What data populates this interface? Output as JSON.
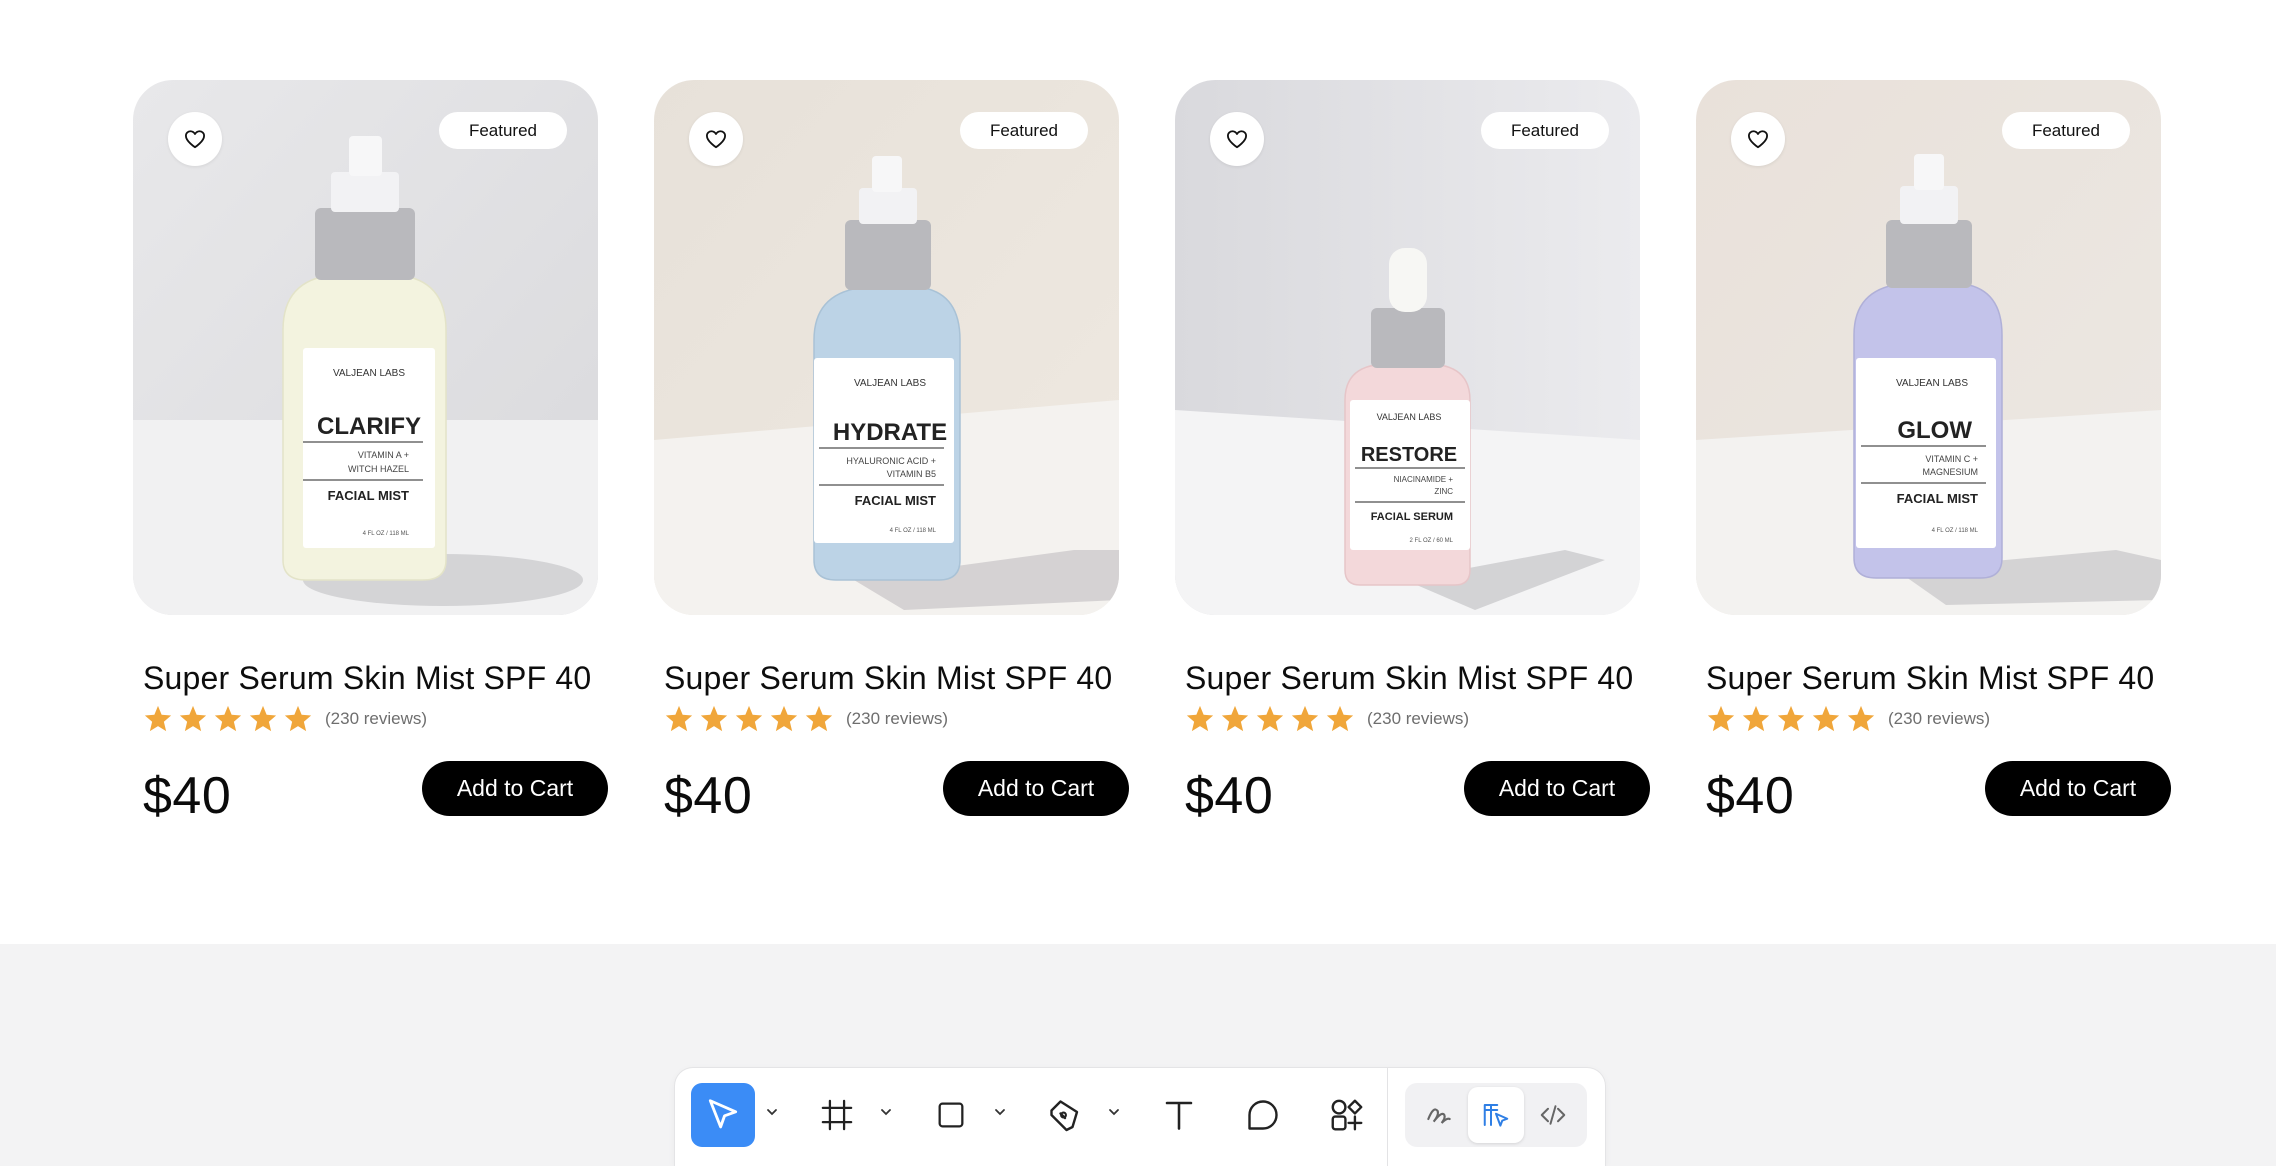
{
  "products": [
    {
      "name": "Super Serum Skin Mist SPF 40",
      "reviews": "(230 reviews)",
      "price": "$40",
      "cta": "Add to Cart",
      "badge": "Featured",
      "rating": 5,
      "brand": "VALJEAN LABS",
      "label_name": "CLARIFY",
      "label_ingredients": [
        "VITAMIN A +",
        "WITCH HAZEL"
      ],
      "label_type": "FACIAL MIST",
      "label_size": "4 FL OZ / 118 ML",
      "liquid_color": "#f3f3df",
      "bg_color": "#e6e6e8"
    },
    {
      "name": "Super Serum Skin Mist SPF 40",
      "reviews": "(230 reviews)",
      "price": "$40",
      "cta": "Add to Cart",
      "badge": "Featured",
      "rating": 5,
      "brand": "VALJEAN LABS",
      "label_name": "HYDRATE",
      "label_ingredients": [
        "HYALURONIC ACID +",
        "VITAMIN B5"
      ],
      "label_type": "FACIAL MIST",
      "label_size": "4 FL OZ / 118 ML",
      "liquid_color": "#bcd3e6",
      "bg_color": "#e8e2da"
    },
    {
      "name": "Super Serum Skin Mist SPF 40",
      "reviews": "(230 reviews)",
      "price": "$40",
      "cta": "Add to Cart",
      "badge": "Featured",
      "rating": 5,
      "brand": "VALJEAN LABS",
      "label_name": "RESTORE",
      "label_ingredients": [
        "NIACINAMIDE +",
        "ZINC"
      ],
      "label_type": "FACIAL SERUM",
      "label_size": "2 FL OZ / 60 ML",
      "liquid_color": "#f3d8da",
      "bg_color": "#e3e3e6"
    },
    {
      "name": "Super Serum Skin Mist SPF 40",
      "reviews": "(230 reviews)",
      "price": "$40",
      "cta": "Add to Cart",
      "badge": "Featured",
      "rating": 5,
      "brand": "VALJEAN LABS",
      "label_name": "GLOW",
      "label_ingredients": [
        "VITAMIN C +",
        "MAGNESIUM"
      ],
      "label_type": "FACIAL MIST",
      "label_size": "4 FL OZ / 118 ML",
      "liquid_color": "#c3c3ea",
      "bg_color": "#e9e2dc"
    }
  ],
  "colors": {
    "star": "#f0a63a",
    "cta_bg": "#000000",
    "active_tool": "#3b8cf6",
    "canvas_bg": "#f3f3f4"
  },
  "toolbar": {
    "tools": [
      {
        "icon": "cursor-icon",
        "active": true,
        "has_menu": true
      },
      {
        "icon": "frame-icon",
        "active": false,
        "has_menu": true
      },
      {
        "icon": "rectangle-icon",
        "active": false,
        "has_menu": true
      },
      {
        "icon": "pen-icon",
        "active": false,
        "has_menu": true
      },
      {
        "icon": "text-icon",
        "active": false,
        "has_menu": false
      },
      {
        "icon": "comment-icon",
        "active": false,
        "has_menu": false
      },
      {
        "icon": "components-icon",
        "active": false,
        "has_menu": false
      }
    ],
    "modes": [
      {
        "icon": "draw-icon",
        "active": false
      },
      {
        "icon": "design-icon",
        "active": true
      },
      {
        "icon": "code-icon",
        "active": false
      }
    ]
  }
}
